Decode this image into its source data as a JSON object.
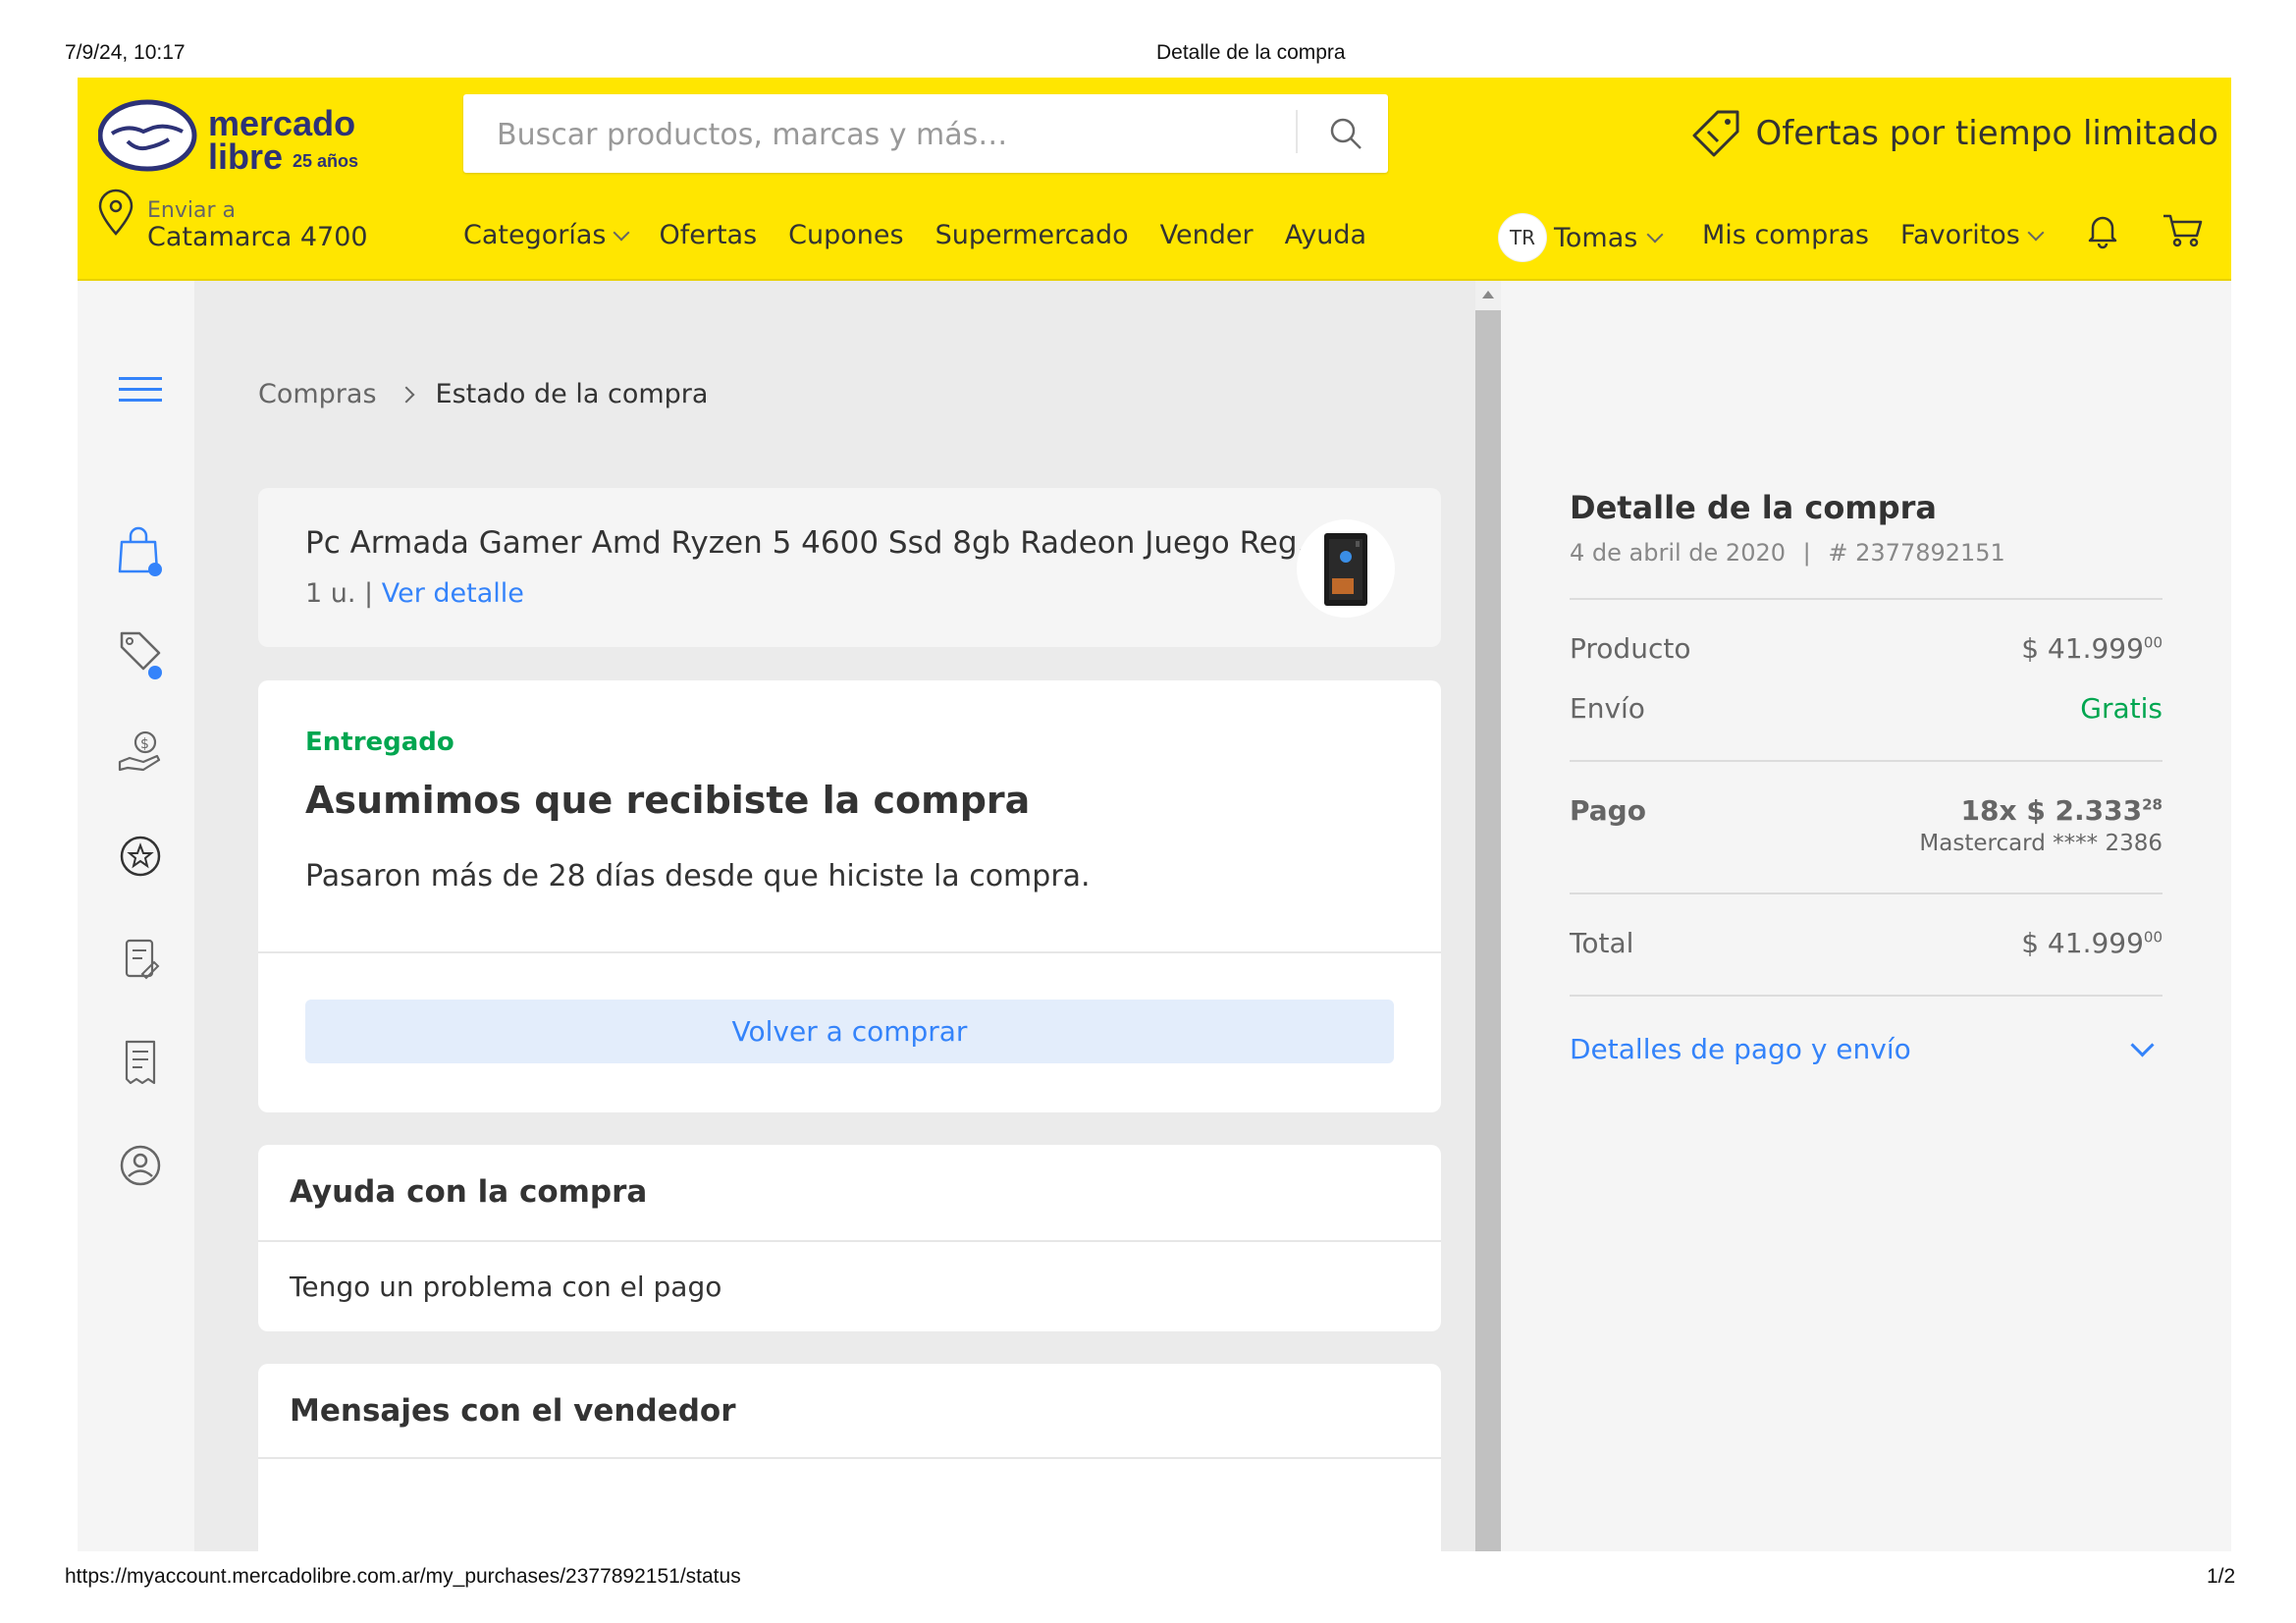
{
  "print_header": {
    "datetime": "7/9/24, 10:17",
    "title": "Detalle de la compra"
  },
  "print_footer": {
    "url": "https://myaccount.mercadolibre.com.ar/my_purchases/2377892151/status",
    "page": "1/2"
  },
  "header": {
    "logo_text": "mercado libre 25 años",
    "search_placeholder": "Buscar productos, marcas y más…",
    "offers_label": "Ofertas por tiempo limitado",
    "location": {
      "label": "Enviar a",
      "value": "Catamarca 4700"
    },
    "nav": [
      "Categorías",
      "Ofertas",
      "Cupones",
      "Supermercado",
      "Vender",
      "Ayuda"
    ],
    "user": {
      "initials": "TR",
      "name": "Tomas"
    },
    "my_purchases": "Mis compras",
    "favorites": "Favoritos"
  },
  "breadcrumb": {
    "parent": "Compras",
    "current": "Estado de la compra"
  },
  "product": {
    "title": "Pc Armada Gamer Amd Ryzen 5 4600 Ssd 8gb Radeon Juego Reg...",
    "qty": "1 u. |",
    "detail_link": "Ver detalle"
  },
  "status": {
    "label": "Entregado",
    "heading": "Asumimos que recibiste la compra",
    "message": "Pasaron más de 28 días desde que hiciste la compra.",
    "button": "Volver a comprar"
  },
  "help": {
    "heading": "Ayuda con la compra",
    "item": "Tengo un problema con el pago"
  },
  "messages": {
    "heading": "Mensajes con el vendedor"
  },
  "summary": {
    "title": "Detalle de la compra",
    "date": "4 de abril de 2020",
    "sep": "|",
    "order_number": "# 2377892151",
    "product_label": "Producto",
    "product_amount": "$ 41.999",
    "product_cents": "00",
    "shipping_label": "Envío",
    "shipping_value": "Gratis",
    "payment_label": "Pago",
    "payment_amount": "18x $ 2.333",
    "payment_cents": "28",
    "payment_card": "Mastercard **** 2386",
    "total_label": "Total",
    "total_amount": "$ 41.999",
    "total_cents": "00",
    "details_link": "Detalles de pago y envío"
  },
  "colors": {
    "header_yellow": "#ffe600",
    "link_blue": "#3483fa",
    "success_green": "#00a650"
  },
  "icons": [
    "handshake-logo",
    "search-icon",
    "offer-tag-icon",
    "location-pin-icon",
    "bell-icon",
    "cart-icon",
    "menu-icon",
    "shopping-bag-icon",
    "tag-icon",
    "money-hand-icon",
    "star-badge-icon",
    "receipt-edit-icon",
    "receipt-icon",
    "user-circle-icon",
    "chevron-down-icon"
  ]
}
